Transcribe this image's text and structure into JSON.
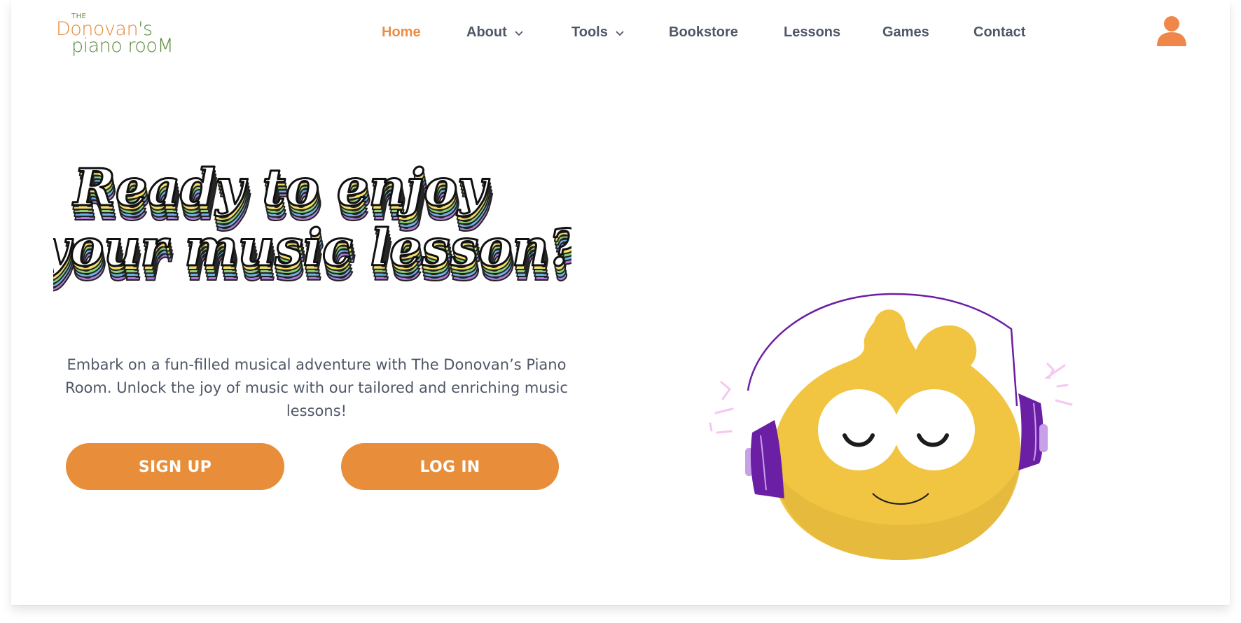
{
  "brand": {
    "logo_line0": "THE",
    "logo_line1a": "Donovan",
    "logo_line1b": "'s",
    "logo_line2": "piano rooM"
  },
  "nav": {
    "items": [
      {
        "label": "Home",
        "active": true,
        "has_dropdown": false
      },
      {
        "label": "About",
        "active": false,
        "has_dropdown": true
      },
      {
        "label": "Tools",
        "active": false,
        "has_dropdown": true
      },
      {
        "label": "Bookstore",
        "active": false,
        "has_dropdown": false
      },
      {
        "label": "Lessons",
        "active": false,
        "has_dropdown": false
      },
      {
        "label": "Games",
        "active": false,
        "has_dropdown": false
      },
      {
        "label": "Contact",
        "active": false,
        "has_dropdown": false
      }
    ],
    "user_icon": "user-icon"
  },
  "hero": {
    "headline_line1": "Ready to enjoy",
    "headline_line2": "your music lesson?",
    "description": "Embark on a fun-filled musical adventure with The Donovan’s Piano Room. Unlock the joy of music with our tailored and enriching music lessons!",
    "signup_label": "SIGN UP",
    "login_label": "LOG IN"
  },
  "colors": {
    "accent": "#e88e3a",
    "nav_text": "#4f5767",
    "nav_active": "#ee8c44",
    "logo_green": "#5b8a3c",
    "logo_orange": "#e58b3a",
    "mascot_yellow": "#f1c542",
    "headphones_purple": "#6a1fa4"
  }
}
